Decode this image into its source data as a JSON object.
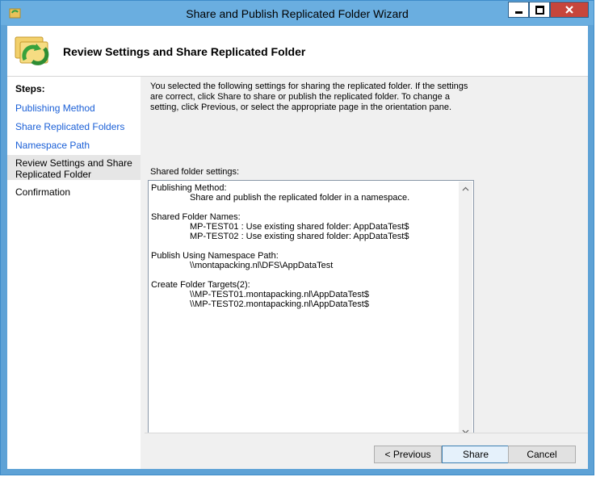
{
  "window": {
    "title": "Share and Publish Replicated Folder Wizard"
  },
  "header": {
    "title": "Review Settings and Share Replicated Folder"
  },
  "steps": {
    "title": "Steps:",
    "items": [
      {
        "label": "Publishing Method",
        "state": "link"
      },
      {
        "label": "Share Replicated Folders",
        "state": "link"
      },
      {
        "label": "Namespace Path",
        "state": "link"
      },
      {
        "label": "Review Settings and Share Replicated Folder",
        "state": "current"
      },
      {
        "label": "Confirmation",
        "state": "plain"
      }
    ]
  },
  "main": {
    "intro": "You selected the following settings for sharing the replicated folder. If the settings are correct, click Share to share or publish the replicated folder. To change a setting, click Previous, or select the appropriate page in the orientation pane.",
    "settings_label": "Shared folder settings:",
    "settings": {
      "publishing_heading": "Publishing Method:",
      "publishing_value": "Share and publish the replicated folder in a namespace.",
      "names_heading": "Shared Folder Names:",
      "names_1": "MP-TEST01 : Use existing shared folder: AppDataTest$",
      "names_2": "MP-TEST02 : Use existing shared folder: AppDataTest$",
      "path_heading": "Publish Using Namespace Path:",
      "path_value": "\\\\montapacking.nl\\DFS\\AppDataTest",
      "targets_heading": "Create Folder Targets(2):",
      "targets_1": "\\\\MP-TEST01.montapacking.nl\\AppDataTest$",
      "targets_2": "\\\\MP-TEST02.montapacking.nl\\AppDataTest$"
    }
  },
  "buttons": {
    "previous": "< Previous",
    "share": "Share",
    "cancel": "Cancel"
  },
  "icons": {
    "title": "wizard-folder-icon",
    "header": "replicated-folder-sync-icon",
    "minimize": "minimize-icon",
    "maximize": "maximize-icon",
    "close": "close-icon",
    "scroll_up": "chevron-up-icon",
    "scroll_down": "chevron-down-icon"
  },
  "colors": {
    "titlebar": "#6aaee0",
    "link": "#1a5fd7",
    "close_button": "#c7463c"
  }
}
